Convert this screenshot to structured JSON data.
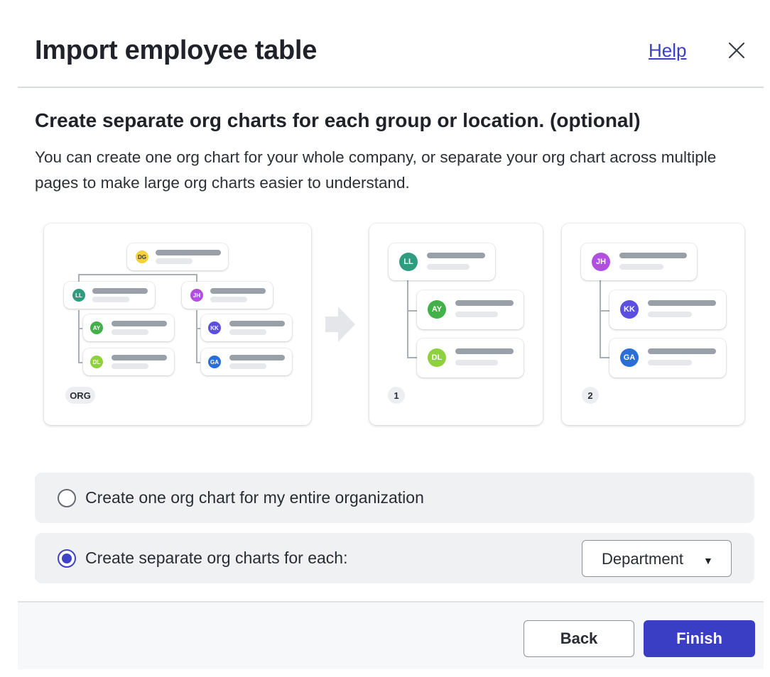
{
  "dialog": {
    "title": "Import employee table",
    "help_label": "Help",
    "heading": "Create separate org charts for each group or location. (optional)",
    "description": "You can create one org chart for your whole company, or separate your org chart across multiple pages to make large org charts easier to understand."
  },
  "illustration": {
    "org_card": {
      "badge": "ORG",
      "nodes": [
        {
          "initials": "DG",
          "color": "#f6d13a",
          "text_color": "#3a3a3a"
        },
        {
          "initials": "LL",
          "color": "#2f9c7f"
        },
        {
          "initials": "JH",
          "color": "#b04fe0"
        },
        {
          "initials": "AY",
          "color": "#43b14a"
        },
        {
          "initials": "DL",
          "color": "#8fd13c"
        },
        {
          "initials": "KK",
          "color": "#5a4fe0"
        },
        {
          "initials": "GA",
          "color": "#2c6ed8"
        }
      ]
    },
    "page1_card": {
      "badge": "1",
      "nodes": [
        {
          "initials": "LL",
          "color": "#2f9c7f"
        },
        {
          "initials": "AY",
          "color": "#43b14a"
        },
        {
          "initials": "DL",
          "color": "#8fd13c"
        }
      ]
    },
    "page2_card": {
      "badge": "2",
      "nodes": [
        {
          "initials": "JH",
          "color": "#b04fe0"
        },
        {
          "initials": "KK",
          "color": "#5a4fe0"
        },
        {
          "initials": "GA",
          "color": "#2c6ed8"
        }
      ]
    }
  },
  "options": {
    "single": {
      "label": "Create one org chart for my entire organization",
      "selected": false
    },
    "separate": {
      "label": "Create separate org charts for each:",
      "selected": true
    },
    "group_by": {
      "value": "Department"
    }
  },
  "footer": {
    "back_label": "Back",
    "finish_label": "Finish"
  },
  "colors": {
    "accent": "#3a3ec5",
    "link": "#3b3fc4"
  }
}
